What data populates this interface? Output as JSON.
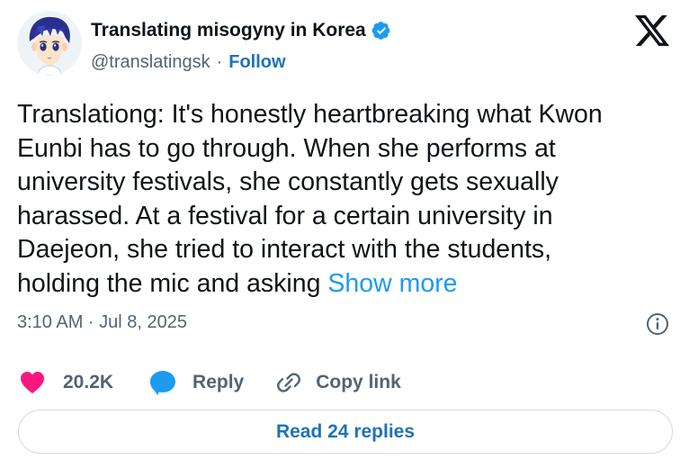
{
  "author": {
    "display_name": "Translating misogyny in Korea",
    "handle": "@translatingsk",
    "separator": "·",
    "follow_label": "Follow",
    "verified": true,
    "avatar_icon": "anime-avatar-icon"
  },
  "tweet": {
    "text_lines": [
      "Translationg: It's honestly heartbreaking what Kwon",
      "Eunbi has to go through. When she performs at",
      "university festivals, she constantly gets sexually",
      "harassed. At a festival for a certain university in",
      "Daejeon, she tried to interact with the students,",
      "holding the mic and asking"
    ],
    "show_more_label": "Show more",
    "timestamp": "3:10 AM · Jul 8, 2025"
  },
  "actions": {
    "like_count": "20.2K",
    "reply_label": "Reply",
    "copy_link_label": "Copy link"
  },
  "read_replies_label": "Read 24 replies",
  "colors": {
    "text": "#0f1419",
    "secondary": "#536471",
    "link": "#1d9bf0",
    "follow": "#1d73b8",
    "like": "#f91880",
    "verified": "#1d9bf0",
    "border": "#cfd9de"
  }
}
